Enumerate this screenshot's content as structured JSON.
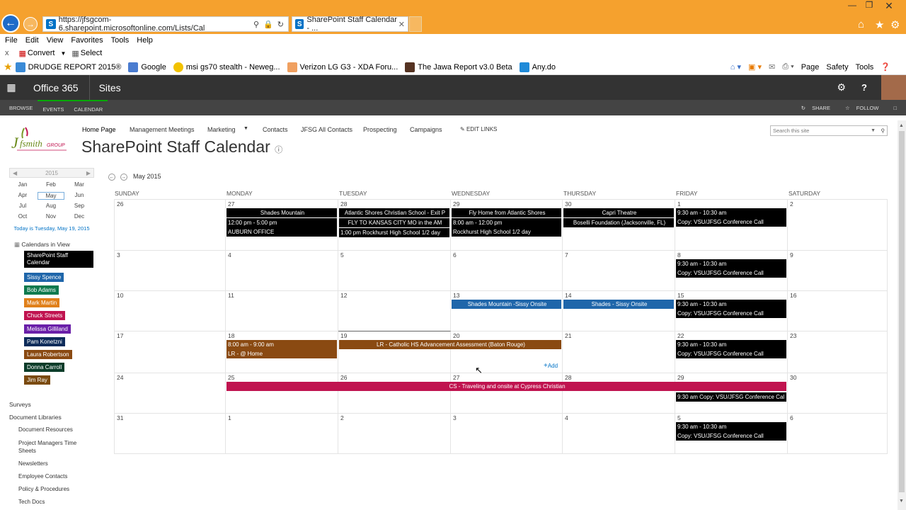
{
  "browser": {
    "url": "https://jfsgcom-6.sharepoint.microsoftonline.com/Lists/Cal",
    "tab_title": "SharePoint Staff Calendar - ...",
    "menu": [
      "File",
      "Edit",
      "View",
      "Favorites",
      "Tools",
      "Help"
    ],
    "cmd": {
      "close": "x",
      "convert": "Convert",
      "select": "Select"
    },
    "favorites": [
      "DRUDGE REPORT 2015®",
      "Google",
      "msi gs70 stealth - Neweg...",
      "Verizon LG G3 - XDA Foru...",
      "The Jawa Report v3.0 Beta",
      "Any.do"
    ],
    "right_tools": [
      "Page",
      "Safety",
      "Tools"
    ]
  },
  "suite": {
    "brand": "Office 365",
    "app": "Sites",
    "ribbon": [
      "BROWSE",
      "EVENTS",
      "CALENDAR"
    ],
    "share": "SHARE",
    "follow": "FOLLOW"
  },
  "site": {
    "nav": [
      "Home Page",
      "Management Meetings",
      "Marketing",
      "Contacts",
      "JFSG All Contacts",
      "Prospecting",
      "Campaigns"
    ],
    "edit_links": "EDIT LINKS",
    "title": "SharePoint Staff Calendar",
    "search_placeholder": "Search this site",
    "logo_text": "Jfsmith GROUP"
  },
  "mini": {
    "year": "2015",
    "months": [
      "Jan",
      "Feb",
      "Mar",
      "Apr",
      "May",
      "Jun",
      "Jul",
      "Aug",
      "Sep",
      "Oct",
      "Nov",
      "Dec"
    ],
    "today": "Today is Tuesday, May 19, 2015"
  },
  "calendars": {
    "header": "Calendars in View",
    "items": [
      {
        "name": "SharePoint Staff Calendar",
        "color": "#000000"
      },
      {
        "name": "Sissy Spence",
        "color": "#1f66aa"
      },
      {
        "name": "Bob Adams",
        "color": "#0e7a4e"
      },
      {
        "name": "Mark Martin",
        "color": "#e0801a"
      },
      {
        "name": "Chuck Streets",
        "color": "#c0134f"
      },
      {
        "name": "Melissa Gilliland",
        "color": "#6a1fa8"
      },
      {
        "name": "Pam Konetzni",
        "color": "#0d2c5a"
      },
      {
        "name": "Laura Robertson",
        "color": "#8a4a12"
      },
      {
        "name": "Donna Carroll",
        "color": "#0c3d2a"
      },
      {
        "name": "Jim Ray",
        "color": "#7a4a0e"
      }
    ]
  },
  "leftnav": {
    "top": [
      "Surveys",
      "Document Libraries"
    ],
    "sub": [
      "Document Resources",
      "Project Managers Time Sheets",
      "Newsletters",
      "Employee Contacts",
      "Policy & Procedures",
      "Tech Docs"
    ]
  },
  "calendar": {
    "title": "May 2015",
    "days": [
      "SUNDAY",
      "MONDAY",
      "TUESDAY",
      "WEDNESDAY",
      "THURSDAY",
      "FRIDAY",
      "SATURDAY"
    ],
    "weeks": [
      [
        "26",
        "27",
        "28",
        "29",
        "30",
        "1",
        "2"
      ],
      [
        "3",
        "4",
        "5",
        "6",
        "7",
        "8",
        "9"
      ],
      [
        "10",
        "11",
        "12",
        "13",
        "14",
        "15",
        "16"
      ],
      [
        "17",
        "18",
        "19",
        "20",
        "21",
        "22",
        "23"
      ],
      [
        "24",
        "25",
        "26",
        "27",
        "28",
        "29",
        "30"
      ],
      [
        "31",
        "1",
        "2",
        "3",
        "4",
        "5",
        "6"
      ]
    ],
    "add": "Add",
    "events": [
      {
        "week": 0,
        "day": 1,
        "span": 1,
        "row": 0,
        "lines": [
          "Shades Mountain"
        ],
        "color": "#000000",
        "center": true
      },
      {
        "week": 0,
        "day": 1,
        "span": 1,
        "row": 1,
        "lines": [
          "12:00 pm - 5:00 pm",
          "AUBURN OFFICE"
        ],
        "color": "#000000"
      },
      {
        "week": 0,
        "day": 2,
        "span": 1,
        "row": 0,
        "lines": [
          "Atlantic Shores Christian School - Exit P"
        ],
        "color": "#000000",
        "center": true
      },
      {
        "week": 0,
        "day": 2,
        "span": 1,
        "row": 1,
        "lines": [
          "FLY TO KANSAS CITY MO in the AM"
        ],
        "color": "#000000",
        "center": true
      },
      {
        "week": 0,
        "day": 2,
        "span": 1,
        "row": 2,
        "lines": [
          "1:00 pm Rockhurst High School 1/2 day"
        ],
        "color": "#000000"
      },
      {
        "week": 0,
        "day": 3,
        "span": 1,
        "row": 0,
        "lines": [
          "Fly Home from Atlantic Shores"
        ],
        "color": "#000000",
        "center": true
      },
      {
        "week": 0,
        "day": 3,
        "span": 1,
        "row": 1,
        "lines": [
          "8:00 am - 12:00 pm",
          "Rockhurst High School 1/2 day"
        ],
        "color": "#000000"
      },
      {
        "week": 0,
        "day": 4,
        "span": 1,
        "row": 0,
        "lines": [
          "Capri Theatre"
        ],
        "color": "#000000",
        "center": true
      },
      {
        "week": 0,
        "day": 4,
        "span": 1,
        "row": 1,
        "lines": [
          "Boselli Foundation (Jacksonville, FL)"
        ],
        "color": "#000000",
        "center": true
      },
      {
        "week": 0,
        "day": 5,
        "span": 1,
        "row": 0,
        "lines": [
          "9:30 am - 10:30 am",
          "Copy: VSU/JFSG Conference Call"
        ],
        "color": "#000000"
      },
      {
        "week": 1,
        "day": 5,
        "span": 1,
        "row": 0,
        "lines": [
          "9:30 am - 10:30 am",
          "Copy: VSU/JFSG Conference Call"
        ],
        "color": "#000000"
      },
      {
        "week": 2,
        "day": 3,
        "span": 1,
        "row": 0,
        "lines": [
          "Shades Mountain -Sissy Onsite"
        ],
        "color": "#1f66aa",
        "center": true
      },
      {
        "week": 2,
        "day": 4,
        "span": 1,
        "row": 0,
        "lines": [
          "Shades - Sissy Onsite"
        ],
        "color": "#1f66aa",
        "center": true
      },
      {
        "week": 2,
        "day": 5,
        "span": 1,
        "row": 0,
        "lines": [
          "9:30 am - 10:30 am",
          "Copy: VSU/JFSG Conference Call"
        ],
        "color": "#000000"
      },
      {
        "week": 3,
        "day": 1,
        "span": 1,
        "row": 0,
        "lines": [
          "8:00 am - 9:00 am",
          "LR - @ Home"
        ],
        "color": "#8a4a12"
      },
      {
        "week": 3,
        "day": 2,
        "span": 2,
        "row": 0,
        "lines": [
          "LR - Catholic HS Advancement Assessment (Baton Rouge)"
        ],
        "color": "#8a4a12",
        "center": true
      },
      {
        "week": 3,
        "day": 5,
        "span": 1,
        "row": 0,
        "lines": [
          "9:30 am - 10:30 am",
          "Copy: VSU/JFSG Conference Call"
        ],
        "color": "#000000"
      },
      {
        "week": 4,
        "day": 1,
        "span": 5,
        "row": 0,
        "lines": [
          "CS - Traveling and onsite at Cypress Christian"
        ],
        "color": "#c0134f",
        "center": true
      },
      {
        "week": 4,
        "day": 5,
        "span": 1,
        "row": 1,
        "lines": [
          "9:30 am Copy: VSU/JFSG Conference Cal"
        ],
        "color": "#000000"
      },
      {
        "week": 5,
        "day": 5,
        "span": 1,
        "row": 0,
        "lines": [
          "9:30 am - 10:30 am",
          "Copy: VSU/JFSG Conference Call"
        ],
        "color": "#000000"
      }
    ]
  }
}
